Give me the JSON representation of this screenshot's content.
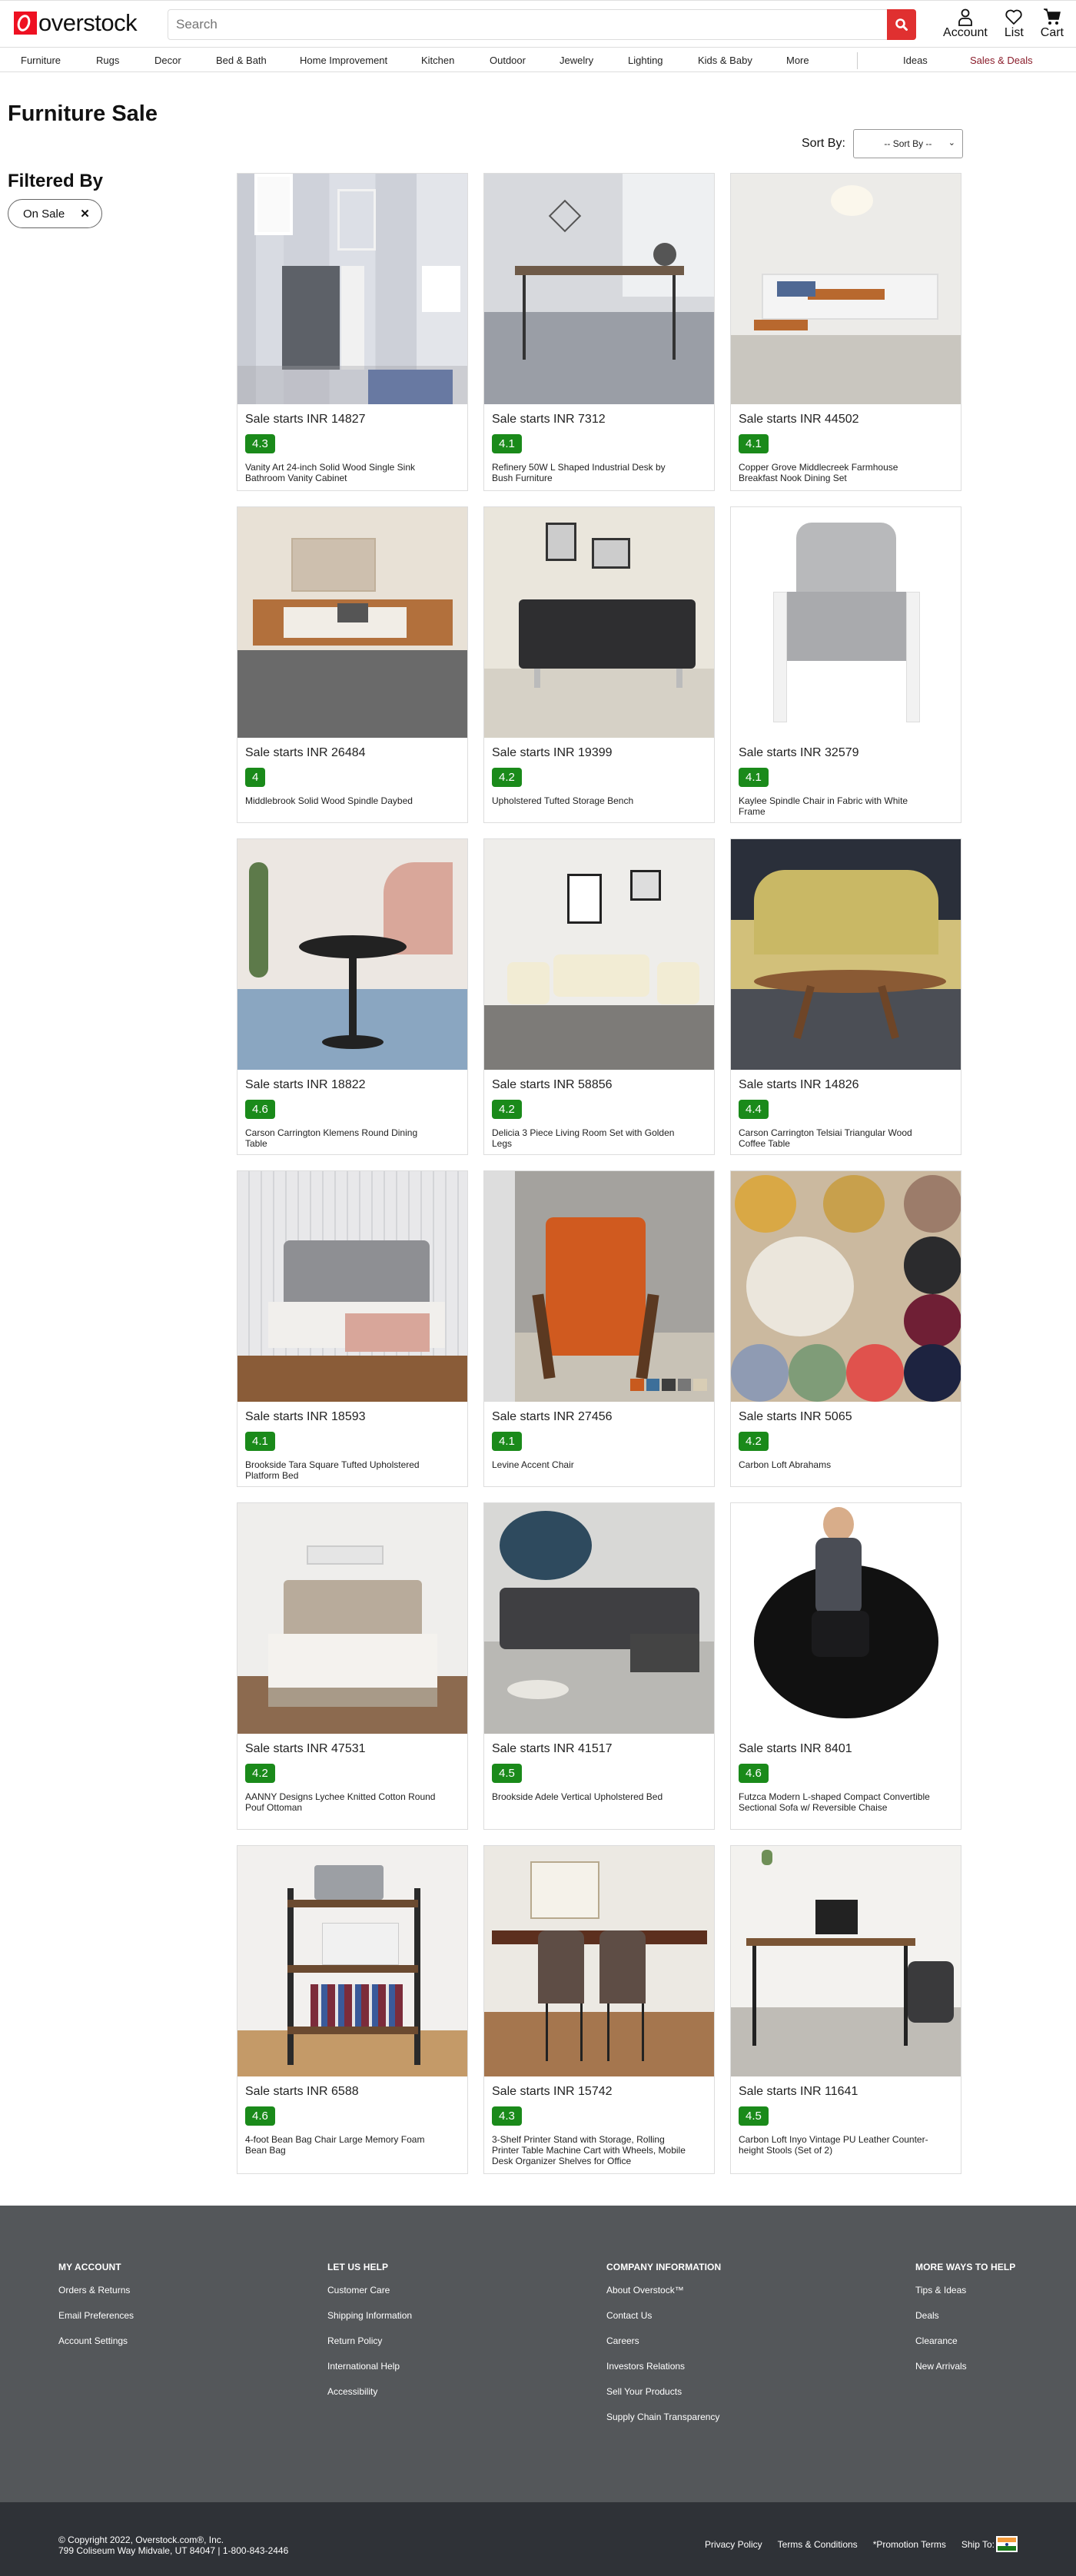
{
  "header": {
    "logo_text": "overstock",
    "search_placeholder": "Search",
    "icons": [
      {
        "name": "account-icon",
        "label": "Account"
      },
      {
        "name": "heart-icon",
        "label": "List"
      },
      {
        "name": "cart-icon",
        "label": "Cart"
      }
    ]
  },
  "nav": {
    "categories": [
      "Furniture",
      "Rugs",
      "Decor",
      "Bed & Bath",
      "Home Improvement",
      "Kitchen",
      "Outdoor",
      "Jewelry",
      "Lighting",
      "Kids & Baby",
      "More"
    ],
    "ideas": "Ideas",
    "deals": "Sales & Deals",
    "deals_color": "#8a1c2a"
  },
  "page": {
    "title": "Furniture Sale",
    "sort_label": "Sort By:",
    "sort_value": "-- Sort By --",
    "filter_title": "Filtered By",
    "filter_chip": "On Sale",
    "filter_remove": "✕"
  },
  "theme": {
    "accent": "#e03030",
    "rating_bg": "#1a8a1a",
    "footer_bg": "#54575a",
    "subfooter_bg": "#2f3237"
  },
  "products": [
    {
      "price": "Sale starts INR 14827",
      "rating": "4.3",
      "name": "Vanity Art 24-inch Solid Wood Single Sink Bathroom Vanity Cabinet"
    },
    {
      "price": "Sale starts INR 7312",
      "rating": "4.1",
      "name": "Refinery 50W L Shaped Industrial Desk by Bush Furniture"
    },
    {
      "price": "Sale starts INR 44502",
      "rating": "4.1",
      "name": "Copper Grove Middlecreek Farmhouse Breakfast Nook Dining Set"
    },
    {
      "price": "Sale starts INR 26484",
      "rating": "4",
      "name": "Middlebrook Solid Wood Spindle Daybed"
    },
    {
      "price": "Sale starts INR 19399",
      "rating": "4.2",
      "name": "Upholstered Tufted Storage Bench"
    },
    {
      "price": "Sale starts INR 32579",
      "rating": "4.1",
      "name": "Kaylee Spindle Chair in Fabric with White Frame"
    },
    {
      "price": "Sale starts INR 18822",
      "rating": "4.6",
      "name": "Carson Carrington Klemens Round Dining Table"
    },
    {
      "price": "Sale starts INR 58856",
      "rating": "4.2",
      "name": "Delicia 3 Piece Living Room Set with Golden Legs"
    },
    {
      "price": "Sale starts INR 14826",
      "rating": "4.4",
      "name": "Carson Carrington Telsiai Triangular Wood Coffee Table"
    },
    {
      "price": "Sale starts INR 18593",
      "rating": "4.1",
      "name": "Brookside Tara Square Tufted Upholstered Platform Bed"
    },
    {
      "price": "Sale starts INR 27456",
      "rating": "4.1",
      "name": "Levine Accent Chair"
    },
    {
      "price": "Sale starts INR 5065",
      "rating": "4.2",
      "name": "Carbon Loft Abrahams"
    },
    {
      "price": "Sale starts INR 47531",
      "rating": "4.2",
      "name": "AANNY Designs Lychee Knitted Cotton Round Pouf Ottoman"
    },
    {
      "price": "Sale starts INR 41517",
      "rating": "4.5",
      "name": "Brookside Adele Vertical Upholstered Bed"
    },
    {
      "price": "Sale starts INR 8401",
      "rating": "4.6",
      "name": "Futzca Modern L-shaped Compact Convertible Sectional Sofa w/ Reversible Chaise"
    },
    {
      "price": "Sale starts INR 6588",
      "rating": "4.6",
      "name": "4-foot Bean Bag Chair Large Memory Foam Bean Bag"
    },
    {
      "price": "Sale starts INR 15742",
      "rating": "4.3",
      "name": "3-Shelf Printer Stand with Storage, Rolling Printer Table Machine Cart with Wheels, Mobile Desk Organizer Shelves for Office"
    },
    {
      "price": "Sale starts INR 11641",
      "rating": "4.5",
      "name": "Carbon Loft Inyo Vintage PU Leather Counter-height Stools (Set of 2)"
    }
  ],
  "footer": {
    "columns": [
      {
        "title": "MY ACCOUNT",
        "links": [
          "Orders & Returns",
          "Email Preferences",
          "Account Settings"
        ]
      },
      {
        "title": "LET US HELP",
        "links": [
          "Customer Care",
          "Shipping Information",
          "Return Policy",
          "International Help",
          "Accessibility"
        ]
      },
      {
        "title": "COMPANY INFORMATION",
        "links": [
          "About Overstock™",
          "Contact Us",
          "Careers",
          "Investors Relations",
          "Sell Your Products",
          "Supply Chain Transparency"
        ]
      },
      {
        "title": "MORE WAYS TO HELP",
        "links": [
          "Tips & Ideas",
          "Deals",
          "Clearance",
          "New Arrivals"
        ]
      }
    ],
    "copyright": "© Copyright 2022, Overstock.com®, Inc.",
    "address": "799 Coliseum Way Midvale, UT 84047 | 1-800-843-2446",
    "legal_links": [
      "Privacy Policy",
      "Terms & Conditions",
      "*Promotion Terms",
      "Ship To:"
    ],
    "ship_to_country": "India"
  }
}
